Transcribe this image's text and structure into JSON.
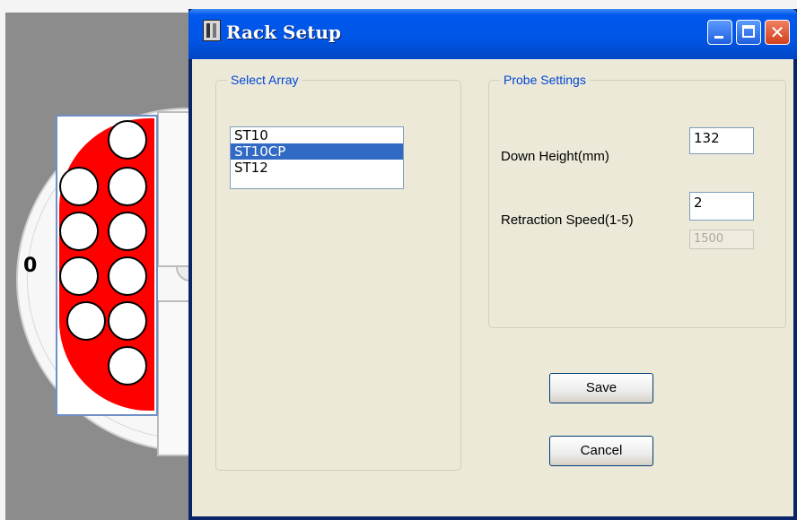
{
  "background": {
    "rack_number": "0"
  },
  "dialog": {
    "title": "Rack Setup",
    "controls": {
      "minimize_icon": "minimize-icon",
      "maximize_icon": "maximize-icon",
      "close_icon": "close-icon",
      "close_glyph": "✕"
    },
    "select_array": {
      "legend": "Select Array",
      "items": [
        "ST10",
        "ST10CP",
        "ST12"
      ],
      "selected": "ST10CP"
    },
    "probe_settings": {
      "legend": "Probe Settings",
      "down_height_label": "Down Height(mm)",
      "down_height_value": "132",
      "retraction_speed_label": "Retraction Speed(1-5)",
      "retraction_speed_value": "2",
      "retraction_speed_hint": "1500"
    },
    "save_label": "Save",
    "cancel_label": "Cancel"
  },
  "colors": {
    "title_bar": "#0055e5",
    "selection": "#316ac5",
    "rack_fill": "#ff0000",
    "group_legend": "#0046d5"
  }
}
